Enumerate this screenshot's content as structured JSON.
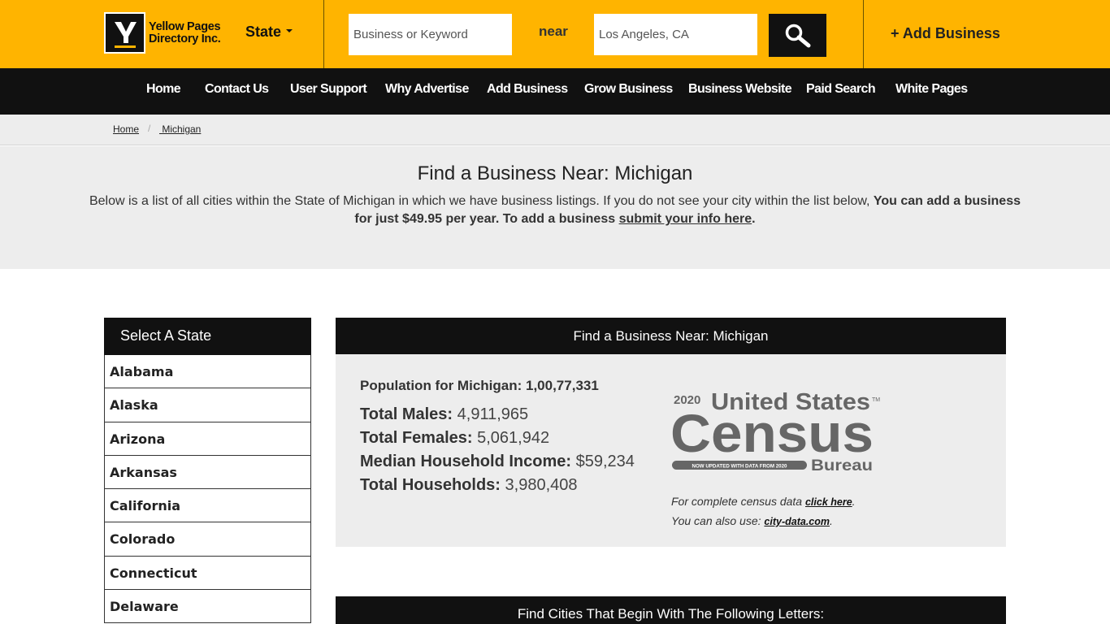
{
  "header": {
    "logo_line1": "Yellow Pages",
    "logo_line2": "Directory Inc.",
    "state_label": "State",
    "search_placeholder": "Business or Keyword",
    "near_label": "near",
    "location_value": "Los Angeles, CA",
    "add_business": "+ Add Business",
    "colors": {
      "yellow": "#ffb400",
      "dark": "#111111"
    }
  },
  "nav": {
    "items": [
      "Home",
      "Contact Us",
      "User Support",
      "Why Advertise",
      "Add Business",
      "Grow Business",
      "Business Website",
      "Paid Search",
      "White Pages"
    ]
  },
  "breadcrumb": {
    "home": "Home",
    "separator": "/",
    "current": " Michigan"
  },
  "intro": {
    "title": "Find a Business Near: Michigan",
    "text": "Below is a list of all cities within the State of Michigan in which we have business listings. If you do not see your city within the list below, ",
    "bold_text": "You can add a business for just $49.95 per year. To add a business ",
    "link_text": "submit your info here",
    "end_text": "."
  },
  "sidebar": {
    "title": "Select A State",
    "states": [
      "Alabama",
      "Alaska",
      "Arizona",
      "Arkansas",
      "California",
      "Colorado",
      "Connecticut",
      "Delaware"
    ]
  },
  "census": {
    "heading": "Find a Business Near: Michigan",
    "population_label": "Population for Michigan:",
    "population_value": "1,00,77,331",
    "males_label": "Total Males:",
    "males_value": "4,911,965",
    "females_label": "Total Females:",
    "females_value": "5,061,942",
    "income_label": "Median Household Income:",
    "income_value": "$59,234",
    "households_label": "Total Households:",
    "households_value": "3,980,408",
    "logo": {
      "year": "2020",
      "line1": "United States",
      "line2": "Census",
      "banner": "NOW UPDATED WITH DATA FROM 2020",
      "bureau": "Bureau",
      "tm": "TM"
    },
    "note1_text": "For complete census data ",
    "note1_link": "click here",
    "note1_end": ".",
    "note2_text": "You can also use: ",
    "note2_link": "city-data.com",
    "note2_end": "."
  },
  "cities": {
    "heading": "Find Cities That Begin With The Following Letters:"
  }
}
